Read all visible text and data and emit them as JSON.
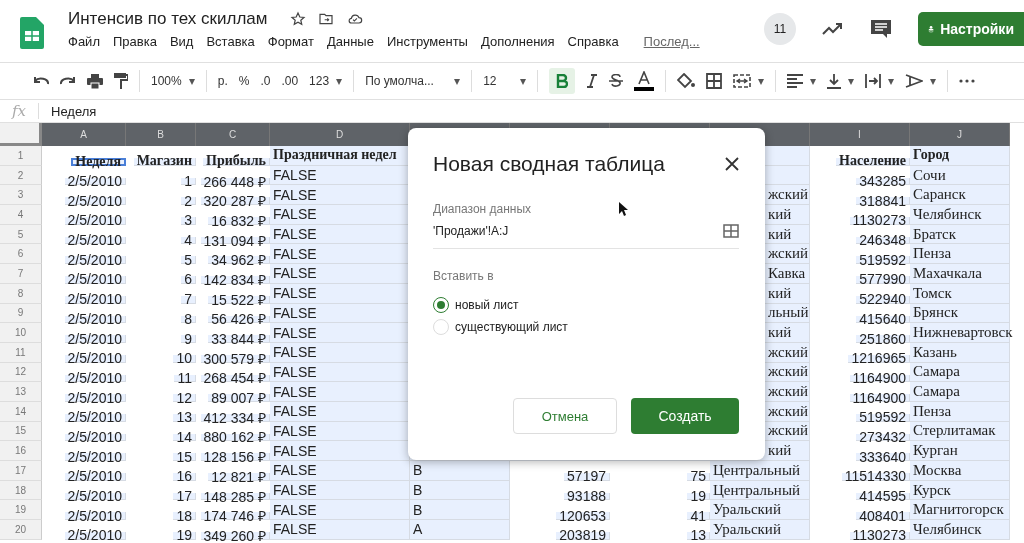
{
  "app": {
    "title": "Интенсив  по тех скиллам",
    "menu": [
      "Файл",
      "Правка",
      "Вид",
      "Вставка",
      "Формат",
      "Данные",
      "Инструменты",
      "Дополнения",
      "Справка"
    ],
    "last_edit": "Послед...",
    "collaborators_count": "11",
    "share_button": "Настройки"
  },
  "toolbar": {
    "zoom": "100%",
    "currency": "р.",
    "percent": "%",
    "decrease_decimals": ".0",
    "increase_decimals": ".00",
    "number_format": "123",
    "font": "По умолча...",
    "font_size": "12",
    "dropdown_arrow": "▾",
    "bold": {
      "on": true
    }
  },
  "formula_bar": {
    "fx": "fx",
    "value": "Неделя"
  },
  "sheet": {
    "columns": [
      {
        "label": "A"
      },
      {
        "label": "B"
      },
      {
        "label": "C"
      },
      {
        "label": "D"
      },
      {},
      {},
      {},
      {},
      {
        "label": "I"
      },
      {
        "label": "J"
      }
    ],
    "rows": [
      {
        "number": "1",
        "cells": {
          "A": "Неделя",
          "B": "Магазин",
          "C": "Прибыль",
          "D": "Праздничная недел",
          "I": "Население",
          "J": "Город"
        }
      },
      {
        "number": "2",
        "cells": {
          "A": "2/5/2010",
          "B": "1",
          "C": "266 448 ₽",
          "D": "FALSE",
          "I": "343285",
          "J": "Сочи"
        }
      },
      {
        "number": "3",
        "cells": {
          "A": "2/5/2010",
          "B": "2",
          "C": "320 287 ₽",
          "D": "FALSE",
          "H": "жский",
          "I": "318841",
          "J": "Саранск"
        }
      },
      {
        "number": "4",
        "cells": {
          "A": "2/5/2010",
          "B": "3",
          "C": "16 832 ₽",
          "D": "FALSE",
          "H": "кий",
          "I": "1130273",
          "J": "Челябинск"
        }
      },
      {
        "number": "5",
        "cells": {
          "A": "2/5/2010",
          "B": "4",
          "C": "131 094 ₽",
          "D": "FALSE",
          "H": "кий",
          "I": "246348",
          "J": "Братск"
        }
      },
      {
        "number": "6",
        "cells": {
          "A": "2/5/2010",
          "B": "5",
          "C": "34 962 ₽",
          "D": "FALSE",
          "H": "жский",
          "I": "519592",
          "J": "Пенза"
        }
      },
      {
        "number": "7",
        "cells": {
          "A": "2/5/2010",
          "B": "6",
          "C": "142 834 ₽",
          "D": "FALSE",
          "H": "Кавка",
          "I": "577990",
          "J": "Махачкала"
        }
      },
      {
        "number": "8",
        "cells": {
          "A": "2/5/2010",
          "B": "7",
          "C": "15 522 ₽",
          "D": "FALSE",
          "H": "кий",
          "I": "522940",
          "J": "Томск"
        }
      },
      {
        "number": "9",
        "cells": {
          "A": "2/5/2010",
          "B": "8",
          "C": "56 426 ₽",
          "D": "FALSE",
          "H": "льный",
          "I": "415640",
          "J": "Брянск"
        }
      },
      {
        "number": "10",
        "cells": {
          "A": "2/5/2010",
          "B": "9",
          "C": "33 844 ₽",
          "D": "FALSE",
          "H": "кий",
          "I": "251860",
          "J": "Нижневартовск"
        }
      },
      {
        "number": "11",
        "cells": {
          "A": "2/5/2010",
          "B": "10",
          "C": "300 579 ₽",
          "D": "FALSE",
          "H": "жский",
          "I": "1216965",
          "J": "Казань"
        }
      },
      {
        "number": "12",
        "cells": {
          "A": "2/5/2010",
          "B": "11",
          "C": "268 454 ₽",
          "D": "FALSE",
          "H": "жский",
          "I": "1164900",
          "J": "Самара"
        }
      },
      {
        "number": "13",
        "cells": {
          "A": "2/5/2010",
          "B": "12",
          "C": "89 007 ₽",
          "D": "FALSE",
          "H": "жский",
          "I": "1164900",
          "J": "Самара"
        }
      },
      {
        "number": "14",
        "cells": {
          "A": "2/5/2010",
          "B": "13",
          "C": "412 334 ₽",
          "D": "FALSE",
          "H": "жский",
          "I": "519592",
          "J": "Пенза"
        }
      },
      {
        "number": "15",
        "cells": {
          "A": "2/5/2010",
          "B": "14",
          "C": "880 162 ₽",
          "D": "FALSE",
          "H": "жский",
          "I": "273432",
          "J": "Стерлитамак"
        }
      },
      {
        "number": "16",
        "cells": {
          "A": "2/5/2010",
          "B": "15",
          "C": "128 156 ₽",
          "D": "FALSE",
          "H": "кий",
          "I": "333640",
          "J": "Курган"
        }
      },
      {
        "number": "17",
        "cells": {
          "A": "2/5/2010",
          "B": "16",
          "C": "12 821 ₽",
          "D": "FALSE",
          "E": "B",
          "F": "57197",
          "G": "75",
          "H": "Центральный",
          "I": "11514330",
          "J": "Москва"
        }
      },
      {
        "number": "18",
        "cells": {
          "A": "2/5/2010",
          "B": "17",
          "C": "148 285 ₽",
          "D": "FALSE",
          "E": "B",
          "F": "93188",
          "G": "19",
          "H": "Центральный",
          "I": "414595",
          "J": "Курск"
        }
      },
      {
        "number": "19",
        "cells": {
          "A": "2/5/2010",
          "B": "18",
          "C": "174 746 ₽",
          "D": "FALSE",
          "E": "B",
          "F": "120653",
          "G": "41",
          "H": "Уральский",
          "I": "408401",
          "J": "Магнитогорск"
        }
      },
      {
        "number": "20",
        "cells": {
          "A": "2/5/2010",
          "B": "19",
          "C": "349 260 ₽",
          "D": "FALSE",
          "E": "A",
          "F": "203819",
          "G": "13",
          "H": "Уральский",
          "I": "1130273",
          "J": "Челябинск"
        }
      }
    ]
  },
  "dialog": {
    "title": "Новая сводная таблица",
    "range_label": "Диапазон данных",
    "range_value": "'Продажи'!A:J",
    "insert_label": "Вставить в",
    "options": [
      {
        "label": "новый лист",
        "selected": true
      },
      {
        "label": "существующий лист",
        "selected": false
      }
    ],
    "cancel_button": "Отмена",
    "create_button": "Создать"
  }
}
